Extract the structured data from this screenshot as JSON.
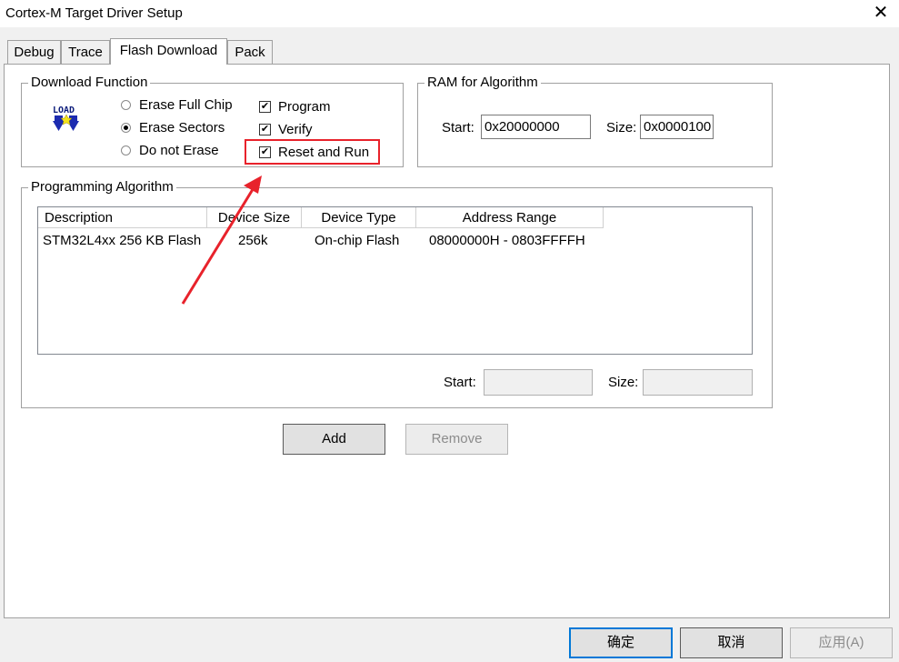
{
  "window": {
    "title": "Cortex-M Target Driver Setup",
    "close_glyph": "✕"
  },
  "tabs": [
    {
      "label": "Debug"
    },
    {
      "label": "Trace"
    },
    {
      "label": "Flash Download",
      "active": true
    },
    {
      "label": "Pack"
    }
  ],
  "download_function": {
    "title": "Download Function",
    "icon": "load-icon",
    "icon_text": "LOAD",
    "radios": [
      {
        "label": "Erase Full Chip",
        "selected": false
      },
      {
        "label": "Erase Sectors",
        "selected": true
      },
      {
        "label": "Do not Erase",
        "selected": false
      }
    ],
    "checks": [
      {
        "label": "Program",
        "checked": true
      },
      {
        "label": "Verify",
        "checked": true
      },
      {
        "label": "Reset and Run",
        "checked": true
      }
    ]
  },
  "ram": {
    "title": "RAM for Algorithm",
    "start_label": "Start:",
    "start_value": "0x20000000",
    "size_label": "Size:",
    "size_value": "0x0000100"
  },
  "algorithm": {
    "title": "Programming Algorithm",
    "columns": [
      "Description",
      "Device Size",
      "Device Type",
      "Address Range"
    ],
    "rows": [
      {
        "description": "STM32L4xx 256 KB Flash",
        "size": "256k",
        "type": "On-chip Flash",
        "range": "08000000H - 0803FFFFH"
      }
    ],
    "start_label": "Start:",
    "start_value": "",
    "size_label": "Size:",
    "size_value": ""
  },
  "buttons": {
    "add": "Add",
    "remove": "Remove",
    "ok": "确定",
    "cancel": "取消",
    "apply": "应用(A)"
  },
  "colors": {
    "highlight": "#e8222b",
    "focus": "#0078d7"
  }
}
